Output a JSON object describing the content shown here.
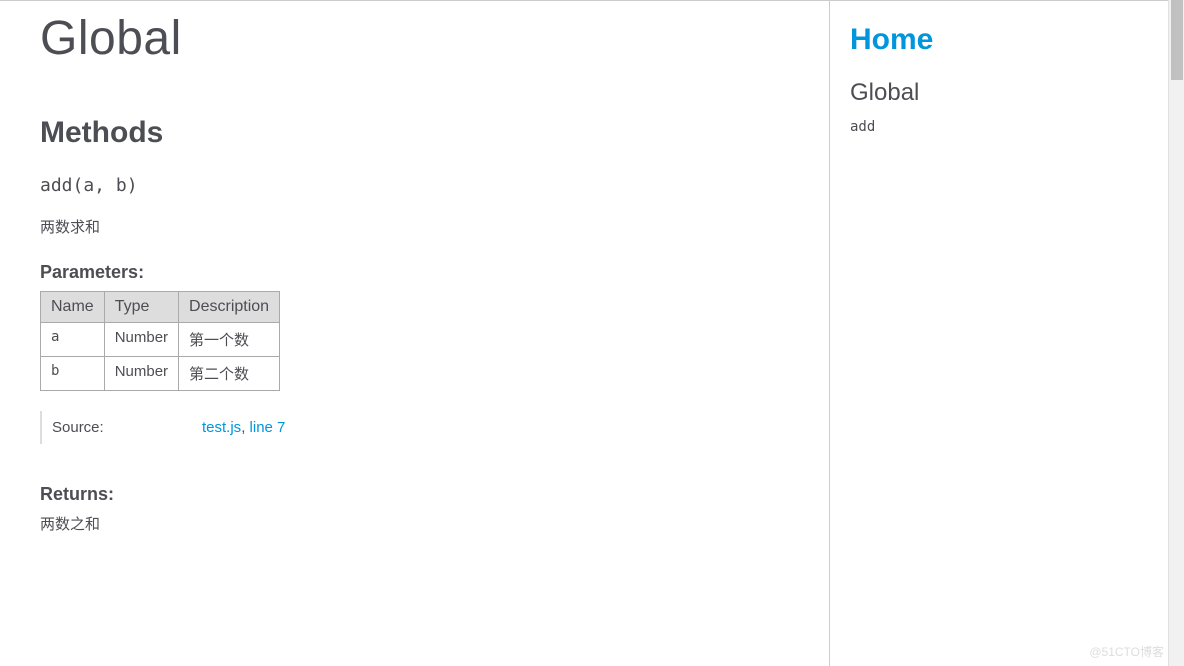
{
  "main": {
    "pageTitle": "Global",
    "sectionTitle": "Methods",
    "method": {
      "signature": "add(a, b)",
      "description": "两数求和",
      "paramsHeading": "Parameters:",
      "paramsHeaders": {
        "name": "Name",
        "type": "Type",
        "desc": "Description"
      },
      "params": [
        {
          "name": "a",
          "type": "Number",
          "desc": "第一个数"
        },
        {
          "name": "b",
          "type": "Number",
          "desc": "第二个数"
        }
      ],
      "sourceLabel": "Source:",
      "sourceFile": "test.js",
      "sourceLine": "line 7",
      "returnsHeading": "Returns:",
      "returnsDesc": "两数之和"
    }
  },
  "nav": {
    "home": "Home",
    "globalHeading": "Global",
    "items": [
      {
        "label": "add"
      }
    ]
  },
  "watermark": "@51CTO博客"
}
